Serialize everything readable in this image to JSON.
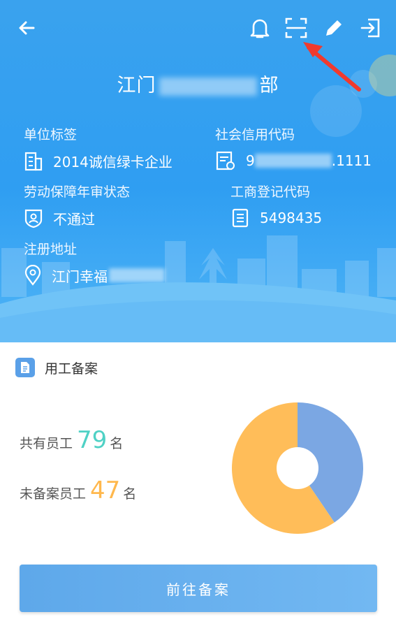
{
  "company": {
    "prefix": "江门",
    "suffix": "部"
  },
  "fields": {
    "unit_tag": {
      "label": "单位标签",
      "value": "2014诚信绿卡企业"
    },
    "credit_code": {
      "label": "社会信用代码",
      "value_start": "9",
      "value_end": ".1111"
    },
    "audit_status": {
      "label": "劳动保障年审状态",
      "value": "不通过"
    },
    "business_code": {
      "label": "工商登记代码",
      "value": "5498435"
    },
    "address": {
      "label": "注册地址",
      "value": "江门幸福"
    }
  },
  "employment": {
    "title": "用工备案",
    "total_label": "共有员工",
    "total": "79",
    "total_unit": "名",
    "unfiled_label": "未备案员工",
    "unfiled": "47",
    "unfiled_unit": "名"
  },
  "chart_data": {
    "type": "pie",
    "donut": true,
    "slices": [
      {
        "value": 32,
        "color": "#7ba7e3"
      },
      {
        "value": 47,
        "color": "#ffbd59"
      }
    ]
  },
  "colors": {
    "header": "#2f9ef2",
    "total_num": "#4fd1c5",
    "unfiled_num": "#ffb84d"
  },
  "button": {
    "label": "前往备案"
  },
  "icons": [
    "back-arrow-icon",
    "bell-icon",
    "scan-icon",
    "edit-icon",
    "exit-icon"
  ]
}
